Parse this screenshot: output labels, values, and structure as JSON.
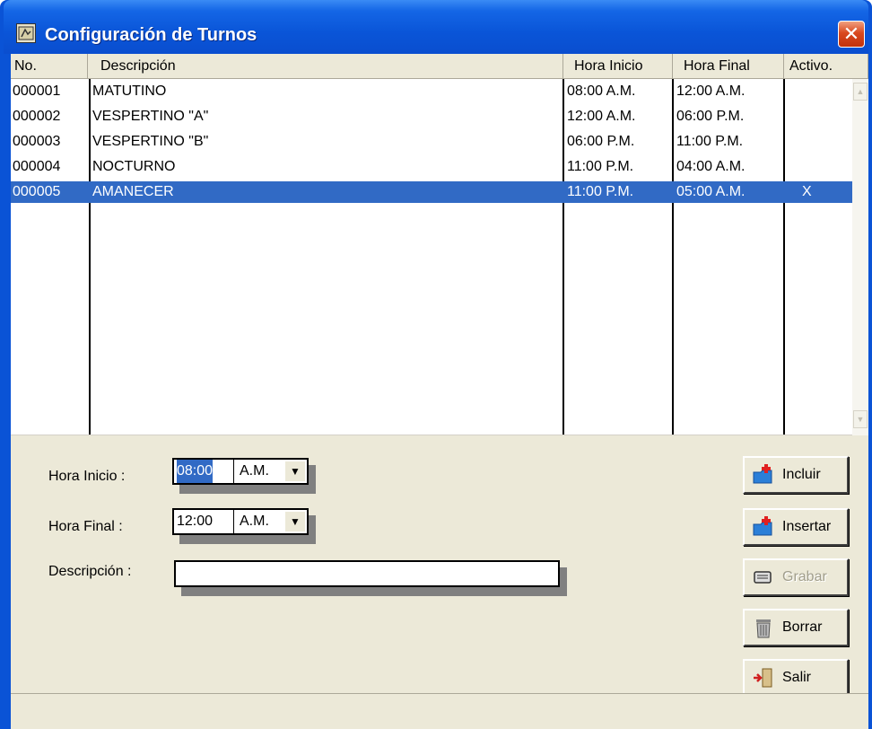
{
  "window": {
    "title": "Configuración de Turnos",
    "close_label": "✕"
  },
  "grid": {
    "columns": [
      "No.",
      "Descripción",
      "Hora Inicio",
      "Hora Final",
      "Activo."
    ],
    "rows": [
      {
        "no": "000001",
        "descripcion": "MATUTINO",
        "inicio": "08:00 A.M.",
        "final": "12:00 A.M.",
        "activo": "",
        "selected": false
      },
      {
        "no": "000002",
        "descripcion": "VESPERTINO \"A\"",
        "inicio": "12:00 A.M.",
        "final": "06:00 P.M.",
        "activo": "",
        "selected": false
      },
      {
        "no": "000003",
        "descripcion": "VESPERTINO \"B\"",
        "inicio": "06:00 P.M.",
        "final": "11:00 P.M.",
        "activo": "",
        "selected": false
      },
      {
        "no": "000004",
        "descripcion": "NOCTURNO",
        "inicio": "11:00 P.M.",
        "final": "04:00 A.M.",
        "activo": "",
        "selected": false
      },
      {
        "no": "000005",
        "descripcion": "AMANECER",
        "inicio": "11:00 P.M.",
        "final": "05:00 A.M.",
        "activo": "X",
        "selected": true
      }
    ]
  },
  "form": {
    "hora_inicio_label": "Hora Inicio :",
    "hora_inicio_time": "08:00",
    "hora_inicio_ampm": "A.M.",
    "hora_final_label": "Hora Final :",
    "hora_final_time": "12:00",
    "hora_final_ampm": "A.M.",
    "descripcion_label": "Descripción :",
    "descripcion_value": ""
  },
  "buttons": {
    "incluir": "Incluir",
    "insertar": "Insertar",
    "grabar": "Grabar",
    "borrar": "Borrar",
    "salir": "Salir"
  },
  "status": {
    "text": ""
  },
  "colors": {
    "titlebar": "#0a55d8",
    "selection": "#316ac5",
    "face": "#ece9d8"
  }
}
